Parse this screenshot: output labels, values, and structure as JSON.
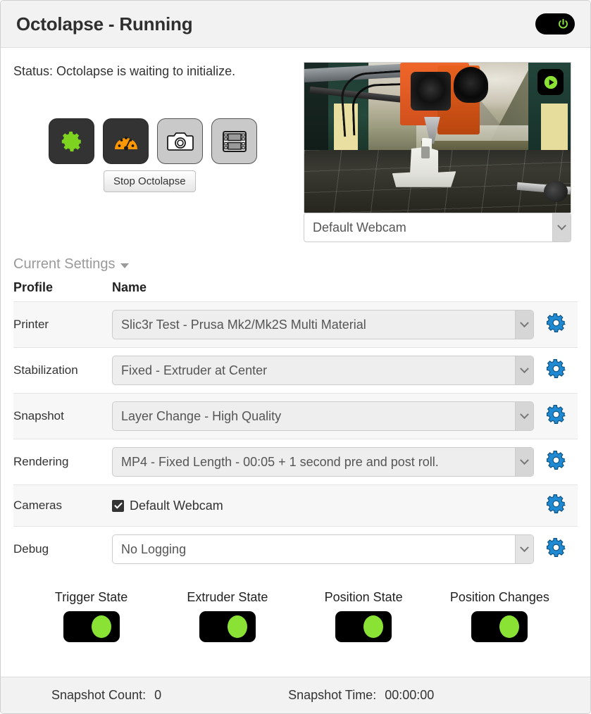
{
  "header": {
    "title": "Octolapse - Running",
    "power_toggle": {
      "name": "power-toggle",
      "state": "on",
      "color": "#8ae234"
    }
  },
  "main": {
    "status_text": "Status: Octolapse is waiting to initialize.",
    "actions": [
      {
        "name": "settings-button",
        "icon": "gear-icon",
        "icon_color": "#7ed321",
        "style": "dark"
      },
      {
        "name": "test-mode-button",
        "icon": "gauge-icon",
        "icon_color": "#ff9800",
        "style": "dark"
      },
      {
        "name": "snapshot-button",
        "icon": "camera-icon",
        "icon_color": "#ffffff",
        "style": "light"
      },
      {
        "name": "timelapse-button",
        "icon": "film-icon",
        "icon_color": "#999999",
        "style": "light"
      }
    ],
    "stop_button_label": "Stop Octolapse",
    "webcam": {
      "play_button": "play-icon",
      "selected_camera": "Default Webcam"
    }
  },
  "settings": {
    "section_label": "Current Settings",
    "columns": {
      "profile": "Profile",
      "name": "Name"
    },
    "rows": [
      {
        "profile": "Printer",
        "value": "Slic3r Test - Prusa Mk2/Mk2S Multi Material",
        "control": "select",
        "striped": true
      },
      {
        "profile": "Stabilization",
        "value": "Fixed - Extruder at Center",
        "control": "select",
        "striped": false
      },
      {
        "profile": "Snapshot",
        "value": "Layer Change - High Quality",
        "control": "select",
        "striped": true
      },
      {
        "profile": "Rendering",
        "value": "MP4 - Fixed Length - 00:05 + 1 second pre and post roll.",
        "control": "select",
        "striped": false
      },
      {
        "profile": "Cameras",
        "value": "Default Webcam",
        "control": "checkbox",
        "checked": true,
        "striped": true
      },
      {
        "profile": "Debug",
        "value": "No Logging",
        "control": "select-white",
        "striped": false
      }
    ],
    "gear_icon_color": "#1f8ad2"
  },
  "states": [
    {
      "label": "Trigger State",
      "on": true
    },
    {
      "label": "Extruder State",
      "on": true
    },
    {
      "label": "Position State",
      "on": true
    },
    {
      "label": "Position Changes",
      "on": true
    }
  ],
  "footer": {
    "snapshot_count_label": "Snapshot Count:",
    "snapshot_count_value": "0",
    "snapshot_time_label": "Snapshot Time:",
    "snapshot_time_value": "00:00:00"
  }
}
